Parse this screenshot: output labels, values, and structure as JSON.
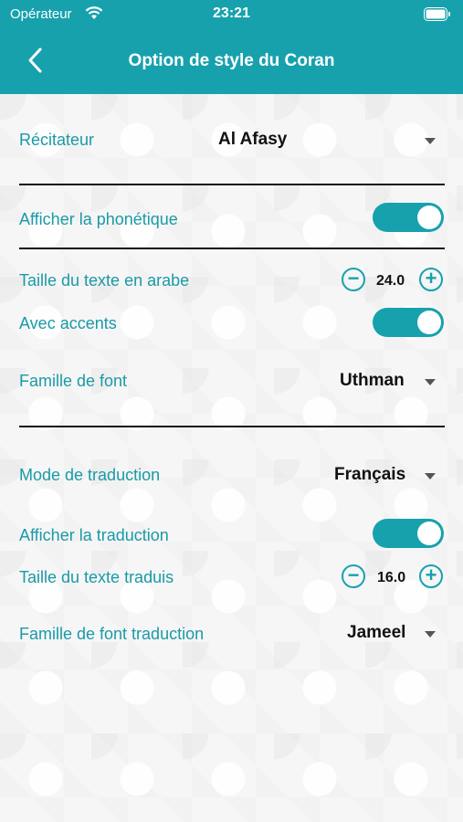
{
  "status_bar": {
    "carrier": "Opérateur",
    "time": "23:21"
  },
  "header": {
    "title": "Option de style du Coran"
  },
  "reciter": {
    "label": "Récitateur",
    "value": "Al Afasy"
  },
  "phonetic": {
    "label": "Afficher la phonétique",
    "enabled": true
  },
  "arabic_size": {
    "label": "Taille du texte en arabe",
    "value": "24.0"
  },
  "accents": {
    "label": "Avec accents",
    "enabled": true
  },
  "font_family": {
    "label": "Famille de font",
    "value": "Uthman"
  },
  "translation_mode": {
    "label": "Mode de traduction",
    "value": "Français"
  },
  "show_translation": {
    "label": "Afficher la traduction",
    "enabled": true
  },
  "translated_size": {
    "label": "Taille du texte traduis",
    "value": "16.0"
  },
  "translation_font": {
    "label": "Famille de font traduction",
    "value": "Jameel"
  },
  "colors": {
    "accent": "#17a1ad"
  },
  "icons": {
    "back": "chevron-left-icon",
    "wifi": "wifi-icon",
    "battery": "battery-icon",
    "minus": "minus-circle-icon",
    "plus": "plus-circle-icon",
    "caret": "caret-down-icon"
  }
}
